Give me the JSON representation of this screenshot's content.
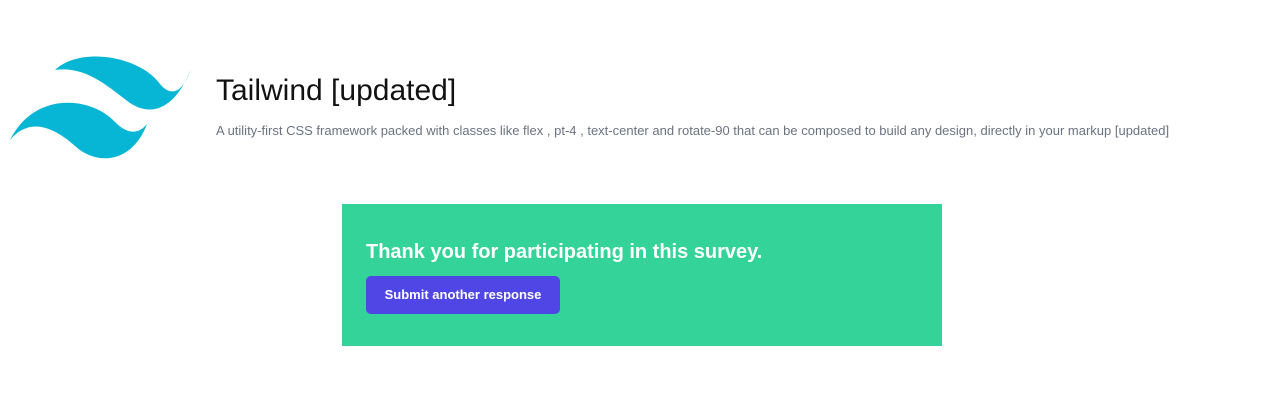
{
  "header": {
    "logo_icon": "tailwind-wave-logo",
    "logo_color": "#06b6d4",
    "title": "Tailwind [updated]",
    "subtitle": "A utility-first CSS framework packed with classes like flex , pt-4 , text-center and rotate-90 that can be composed to build any design, directly in your markup [updated]"
  },
  "survey": {
    "background_color": "#34d399",
    "message": "Thank you for participating in this survey.",
    "button_label": "Submit another response",
    "button_color": "#4f46e5"
  }
}
